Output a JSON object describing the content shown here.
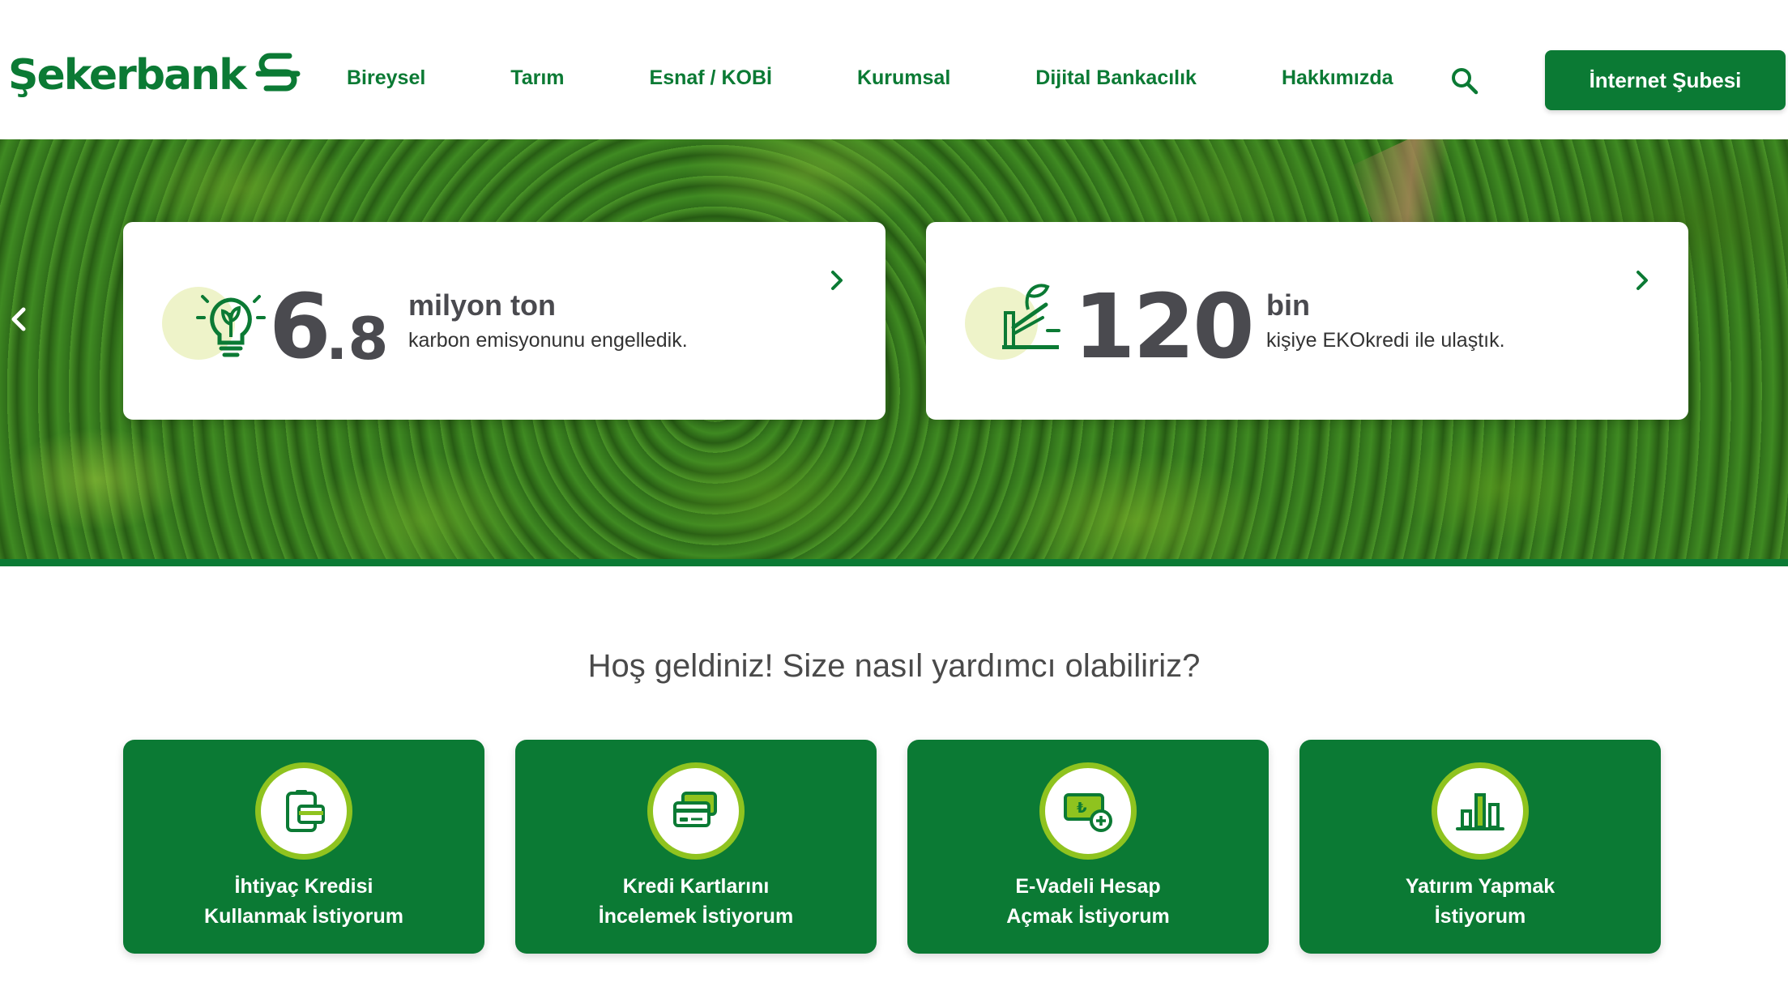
{
  "brand": {
    "name": "Şekerbank",
    "color": "#0b7a34",
    "accent": "#8fc31f"
  },
  "nav": {
    "items": [
      {
        "label": "Bireysel"
      },
      {
        "label": "Tarım"
      },
      {
        "label": "Esnaf / KOBİ"
      },
      {
        "label": "Kurumsal"
      },
      {
        "label": "Dijital Bankacılık"
      },
      {
        "label": "Hakkımızda"
      }
    ],
    "search_icon": "search-icon",
    "cta_label": "İnternet Şubesi"
  },
  "hero": {
    "prev_icon": "chevron-left-icon",
    "cards": [
      {
        "icon": "lightbulb-leaf-icon",
        "big": "6",
        "big_suffix": ".8",
        "unit": "milyon ton",
        "desc": "karbon emisyonunu engelledik.",
        "chev_icon": "chevron-right-icon"
      },
      {
        "icon": "wind-turbine-icon",
        "big": "120",
        "big_suffix": "",
        "unit": "bin",
        "desc": "kişiye EKOkredi ile ulaştık.",
        "chev_icon": "chevron-right-icon"
      }
    ]
  },
  "welcome": {
    "title": "Hoş geldiniz! Size nasıl yardımcı olabiliriz?"
  },
  "tiles": [
    {
      "icon": "wallet-card-icon",
      "label": "İhtiyaç Kredisi\nKullanmak İstiyorum"
    },
    {
      "icon": "credit-cards-icon",
      "label": "Kredi Kartlarını\nİncelemek İstiyorum"
    },
    {
      "icon": "deposit-account-icon",
      "label": "E-Vadeli Hesap\nAçmak İstiyorum"
    },
    {
      "icon": "bar-chart-icon",
      "label": "Yatırım Yapmak\nİstiyorum"
    }
  ]
}
